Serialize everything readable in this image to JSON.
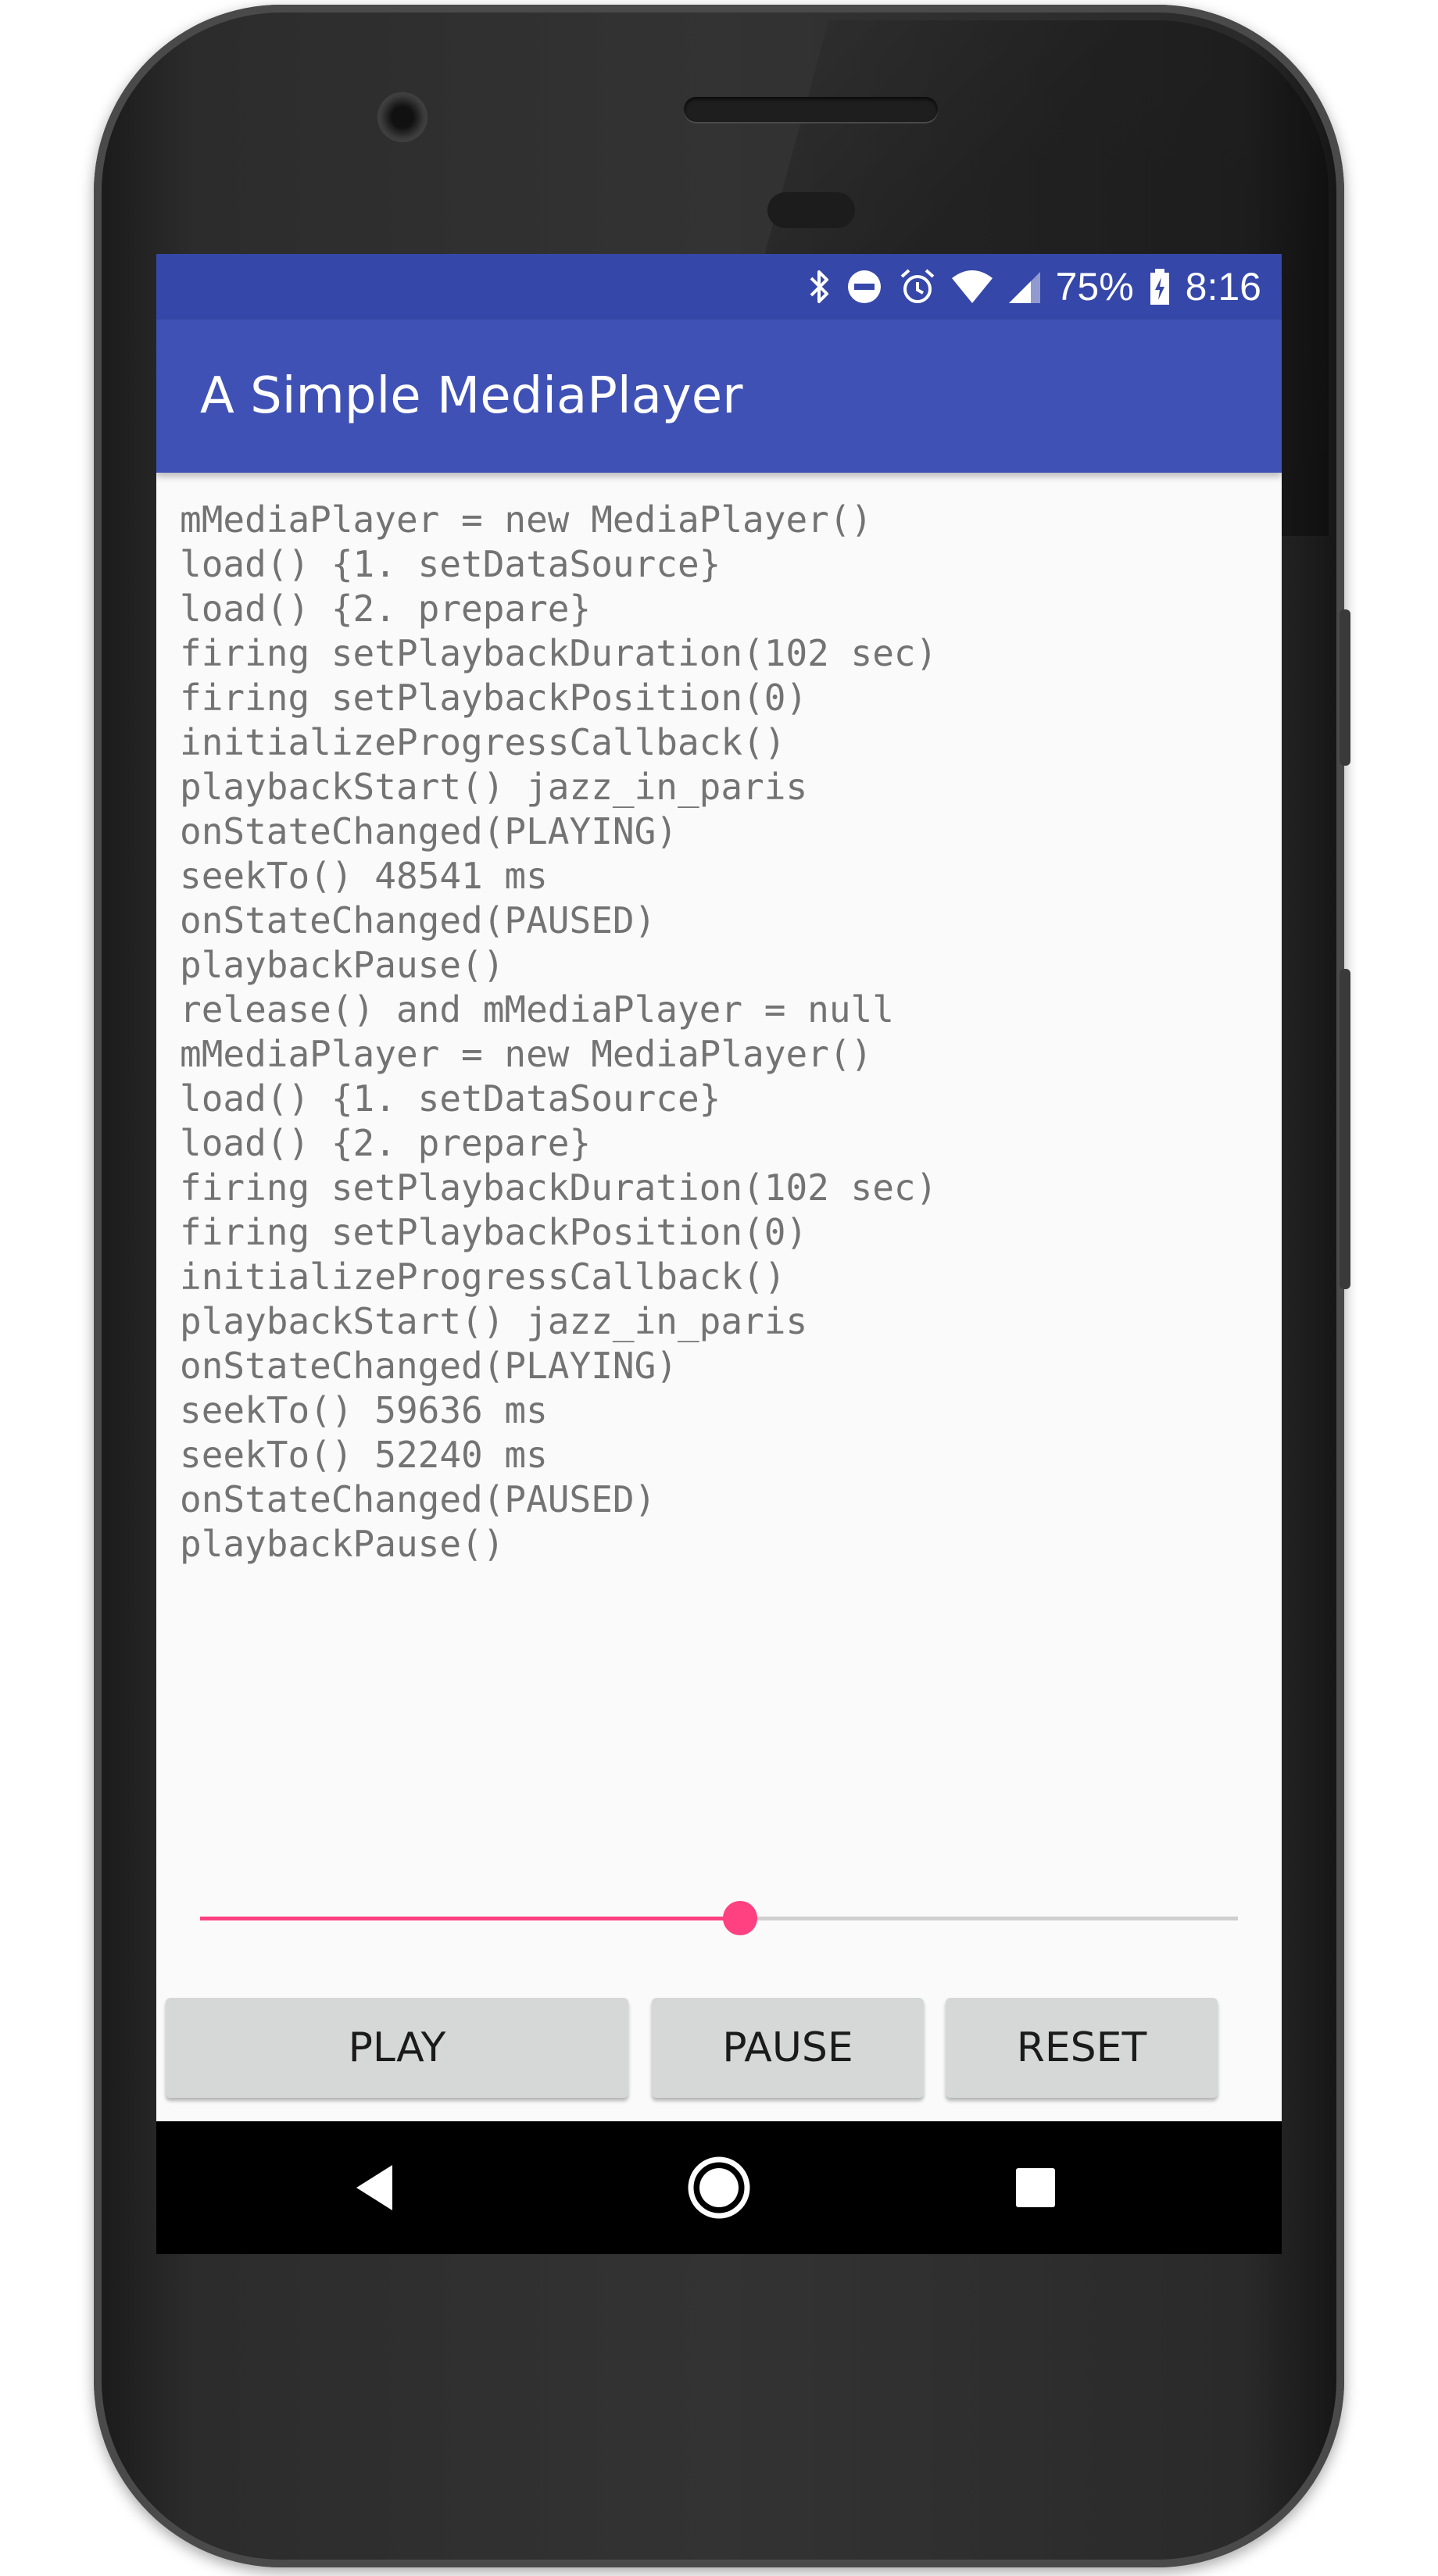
{
  "status_bar": {
    "icons": [
      "bluetooth-icon",
      "do-not-disturb-icon",
      "alarm-icon",
      "wifi-icon",
      "cell-signal-icon",
      "battery-charging-icon"
    ],
    "battery": "75%",
    "time": "8:16",
    "background_color": "#3547a8"
  },
  "app_bar": {
    "title": "A Simple MediaPlayer",
    "background_color": "#3f51b5"
  },
  "log": {
    "lines": [
      "mMediaPlayer = new MediaPlayer()",
      "load() {1. setDataSource}",
      "load() {2. prepare}",
      "firing setPlaybackDuration(102 sec)",
      "firing setPlaybackPosition(0)",
      "initializeProgressCallback()",
      "playbackStart() jazz_in_paris",
      "onStateChanged(PLAYING)",
      "seekTo() 48541 ms",
      "onStateChanged(PAUSED)",
      "playbackPause()",
      "release() and mMediaPlayer = null",
      "mMediaPlayer = new MediaPlayer()",
      "load() {1. setDataSource}",
      "load() {2. prepare}",
      "firing setPlaybackDuration(102 sec)",
      "firing setPlaybackPosition(0)",
      "initializeProgressCallback()",
      "playbackStart() jazz_in_paris",
      "onStateChanged(PLAYING)",
      "seekTo() 59636 ms",
      "seekTo() 52240 ms",
      "onStateChanged(PAUSED)",
      "playbackPause()"
    ]
  },
  "seekbar": {
    "progress_fraction": 0.52,
    "accent_color": "#ff4081"
  },
  "controls": {
    "play_label": "PLAY",
    "pause_label": "PAUSE",
    "reset_label": "RESET"
  },
  "nav_bar": {
    "icons": [
      "back-icon",
      "home-icon",
      "recents-icon"
    ]
  }
}
